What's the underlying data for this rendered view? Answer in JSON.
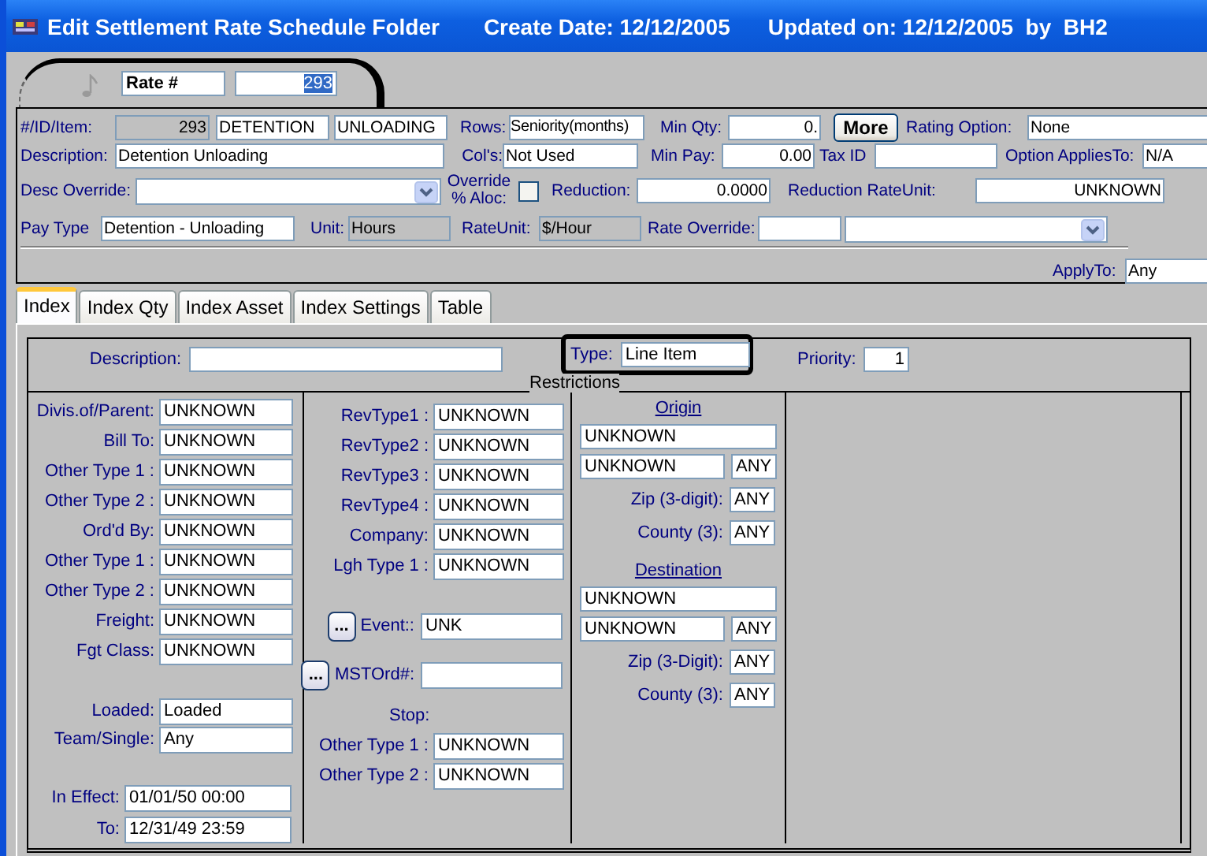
{
  "window": {
    "title": "Edit Settlement Rate Schedule Folder",
    "create_date": "Create Date: 12/12/2005",
    "updated": "Updated on: 12/12/2005  by  BH2"
  },
  "rate": {
    "label": "Rate #",
    "value": "293",
    "selected": true
  },
  "header": {
    "id_item": {
      "label": "#/ID/Item:",
      "number": "293",
      "readonly": true,
      "id": "DETENTION",
      "item": "UNLOADING"
    },
    "rows": {
      "label": "Rows:",
      "value": "Seniority(months)"
    },
    "min_qty": {
      "label": "Min Qty:",
      "value": "0."
    },
    "more_button": "More",
    "rating_option": {
      "label": "Rating Option:",
      "value": "None"
    },
    "description": {
      "label": "Description:",
      "value": "Detention Unloading"
    },
    "cols": {
      "label": "Col's:",
      "value": "Not Used"
    },
    "min_pay": {
      "label": "Min Pay:",
      "value": "0.00"
    },
    "tax_id": {
      "label": "Tax ID"
    },
    "option_applies_to": {
      "label": "Option AppliesTo:",
      "value": "N/A"
    },
    "desc_override": {
      "label": "Desc Override:"
    },
    "override_aloc": {
      "label": "Override % Aloc:",
      "checked": false
    },
    "reduction": {
      "label": "Reduction:",
      "value": "0.0000"
    },
    "reduction_rate_unit": {
      "label": "Reduction RateUnit:",
      "value": "UNKNOWN"
    },
    "pay_type": {
      "label": "Pay Type",
      "value": "Detention - Unloading"
    },
    "unit": {
      "label": "Unit:",
      "value": "Hours",
      "readonly": true
    },
    "rate_unit": {
      "label": "RateUnit:",
      "value": "$/Hour",
      "readonly": true
    },
    "rate_override": {
      "label": "Rate Override:"
    },
    "apply_to": {
      "label": "ApplyTo:",
      "value": "Any"
    }
  },
  "tabs": [
    {
      "label": "Index",
      "selected": true
    },
    {
      "label": "Index Qty",
      "selected": false
    },
    {
      "label": "Index Asset",
      "selected": false
    },
    {
      "label": "Index Settings",
      "selected": false
    },
    {
      "label": "Table",
      "selected": false
    }
  ],
  "index": {
    "description": {
      "label": "Description:"
    },
    "type": {
      "label": "Type:",
      "value": "Line Item"
    },
    "priority": {
      "label": "Priority:",
      "value": "1"
    },
    "restrictions_title": "Restrictions",
    "column_1": [
      {
        "kind": "standard",
        "fields": [
          {
            "label": "Divis.of/Parent:",
            "value": "UNKNOWN"
          },
          {
            "label": "Bill To:",
            "value": "UNKNOWN"
          },
          {
            "label": "Other Type 1 :",
            "value": "UNKNOWN"
          },
          {
            "label": "Other Type 2 :",
            "value": "UNKNOWN"
          },
          {
            "label": "Ord'd By:",
            "value": "UNKNOWN"
          },
          {
            "label": "Other Type 1 :",
            "value": "UNKNOWN"
          },
          {
            "label": "Other Type 2 :",
            "value": "UNKNOWN"
          },
          {
            "label": "Freight:",
            "value": "UNKNOWN"
          },
          {
            "label": "Fgt Class:",
            "value": "UNKNOWN"
          }
        ]
      },
      {
        "kind": "standard",
        "fields": [
          {
            "label": "Loaded:",
            "value": "Loaded"
          },
          {
            "label": "Team/Single:",
            "value": "Any"
          }
        ]
      },
      {
        "kind": "dates",
        "fields": [
          {
            "label": "In Effect:",
            "value": "01/01/50 00:00"
          },
          {
            "label": "To:",
            "value": "12/31/49 23:59"
          }
        ]
      }
    ],
    "column_2": [
      {
        "kind": "field",
        "label": "RevType1 :",
        "value": "UNKNOWN"
      },
      {
        "kind": "field",
        "label": "RevType2 :",
        "value": "UNKNOWN"
      },
      {
        "kind": "field",
        "label": "RevType3 :",
        "value": "UNKNOWN"
      },
      {
        "kind": "field",
        "label": "RevType4 :",
        "value": "UNKNOWN"
      },
      {
        "kind": "field",
        "label": "Company:",
        "value": "UNKNOWN"
      },
      {
        "kind": "field",
        "label": "Lgh Type 1 :",
        "value": "UNKNOWN"
      },
      {
        "kind": "lookup",
        "button": "...",
        "label": "Event::",
        "value": "UNK"
      },
      {
        "kind": "lookup",
        "button": "...",
        "label": "MSTOrd#:"
      },
      {
        "kind": "heading",
        "label": "Stop:"
      },
      {
        "kind": "field",
        "label": "Other Type 1 :",
        "value": "UNKNOWN"
      },
      {
        "kind": "field",
        "label": "Other Type 2 :",
        "value": "UNKNOWN"
      }
    ],
    "places": [
      {
        "title": "Origin",
        "place": "UNKNOWN",
        "area": "UNKNOWN",
        "area_code": "ANY",
        "zip": {
          "label": "Zip (3-digit):",
          "value": "ANY"
        },
        "county": {
          "label": "County (3):",
          "value": "ANY"
        }
      },
      {
        "title": "Destination",
        "place": "UNKNOWN",
        "area": "UNKNOWN",
        "area_code": "ANY",
        "zip": {
          "label": "Zip (3-Digit):",
          "value": "ANY"
        },
        "county": {
          "label": "County (3):",
          "value": "ANY"
        }
      }
    ]
  }
}
